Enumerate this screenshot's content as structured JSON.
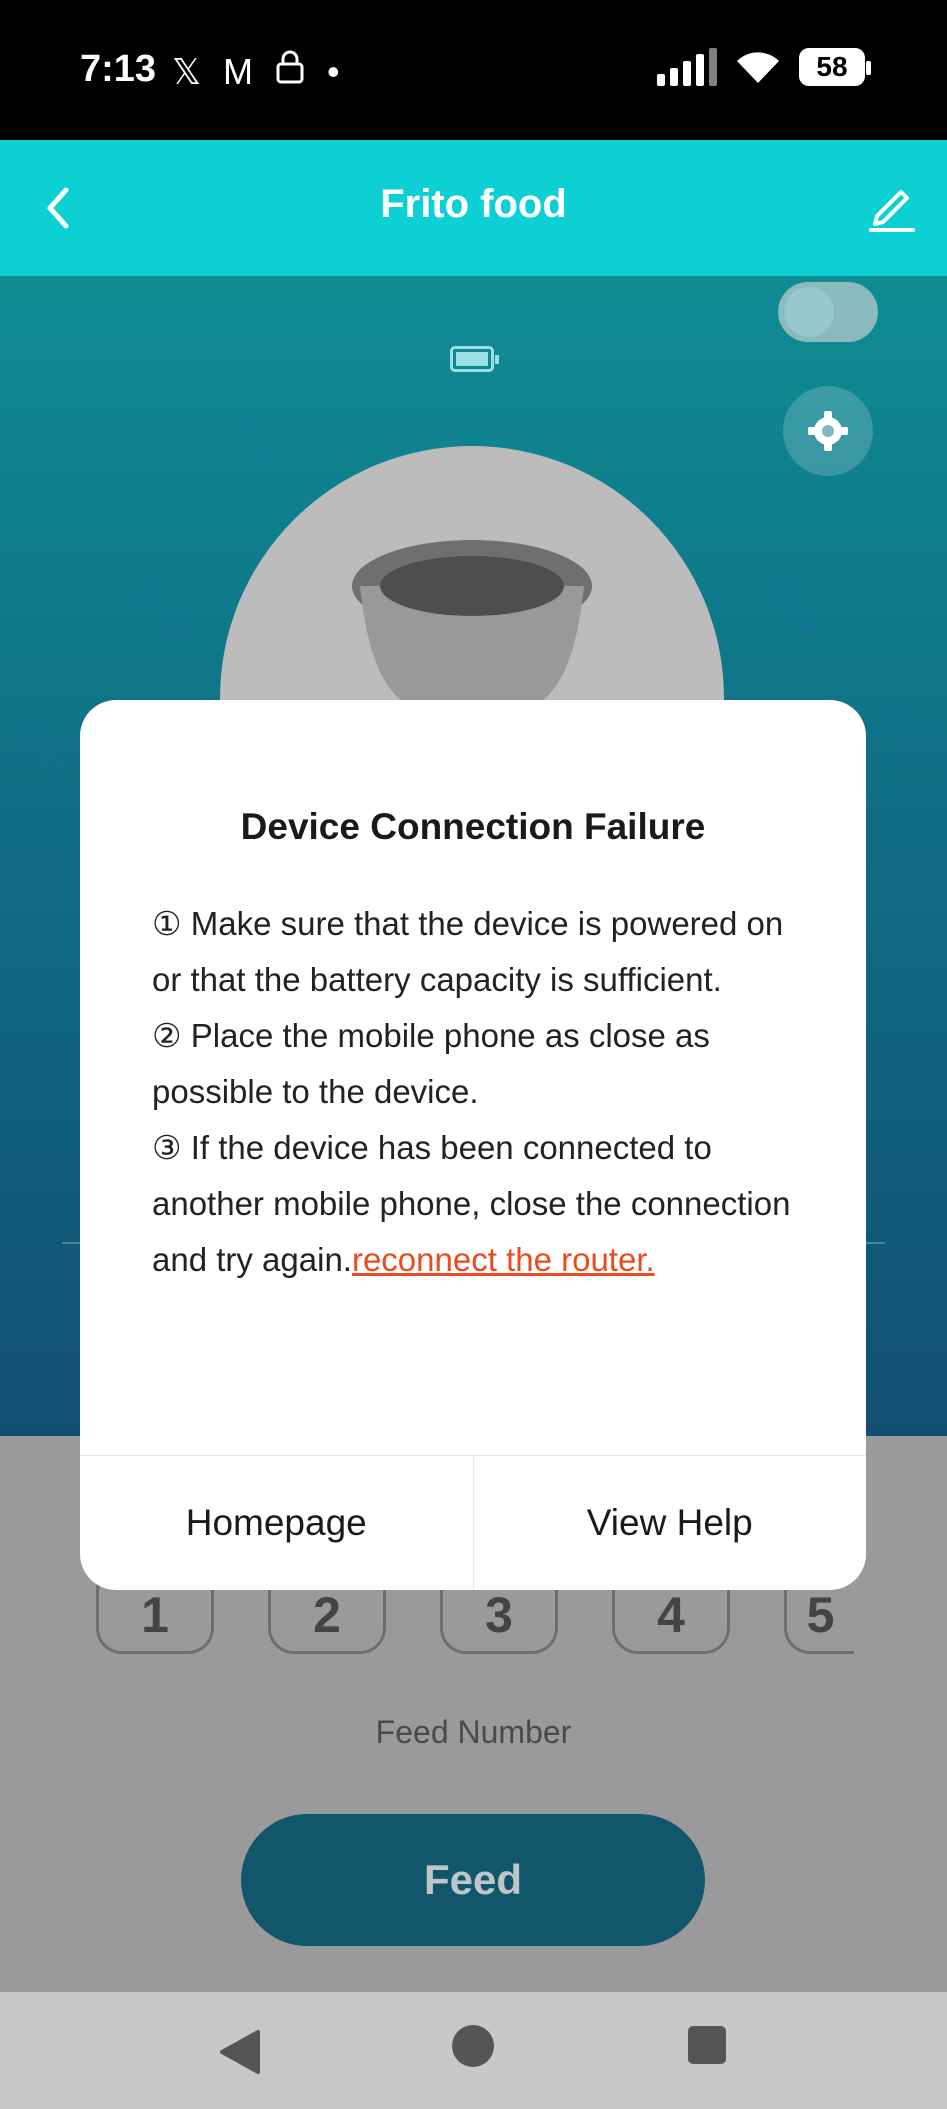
{
  "status_bar": {
    "time": "7:13",
    "notification_icons": [
      "x-icon",
      "gmail-icon",
      "lock-icon",
      "dot-icon"
    ],
    "battery_level": "58"
  },
  "header": {
    "title": "Frito food"
  },
  "hero": {
    "toggle_state": "off"
  },
  "feed_numbers": [
    "1",
    "2",
    "3",
    "4",
    "5"
  ],
  "feed": {
    "label": "Feed Number",
    "button_label": "Feed"
  },
  "dialog": {
    "title": "Device Connection Failure",
    "items": [
      "① Make sure that the device is powered on or that the battery capacity is sufficient.",
      "② Place the mobile phone as close as possible to the device.",
      "③ If the device has been connected to another mobile phone, close the connection and try again."
    ],
    "link_text": "reconnect the router.",
    "buttons": {
      "homepage": "Homepage",
      "view_help": "View Help"
    }
  },
  "colors": {
    "header_bg": "#0cd0d4",
    "link": "#ea4b1f",
    "feed_button": "#11566b"
  }
}
